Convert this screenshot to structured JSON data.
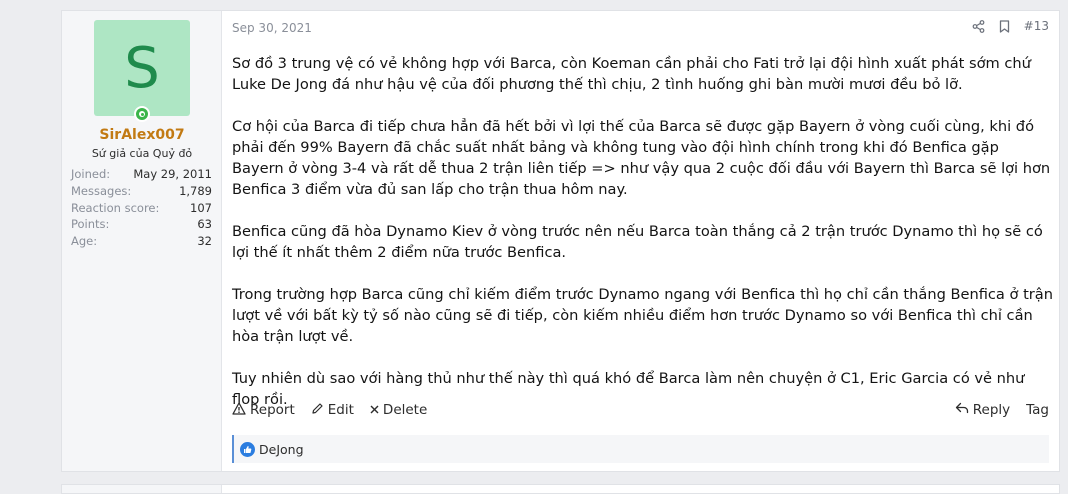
{
  "user": {
    "avatar_letter": "S",
    "username": "SirAlex007",
    "title": "Sứ giả của Quỷ đỏ",
    "stats": [
      {
        "label": "Joined:",
        "value": "May 29, 2011"
      },
      {
        "label": "Messages:",
        "value": "1,789"
      },
      {
        "label": "Reaction score:",
        "value": "107"
      },
      {
        "label": "Points:",
        "value": "63"
      },
      {
        "label": "Age:",
        "value": "32"
      }
    ]
  },
  "post": {
    "date": "Sep 30, 2021",
    "number": "#13",
    "paragraphs": [
      "Sơ đồ 3 trung vệ có vẻ không hợp với Barca, còn Koeman cần phải cho Fati trở lại đội hình xuất phát sớm chứ Luke De Jong đá như hậu vệ của đối phương thế thì chịu, 2 tình huống ghi bàn mười mươi đều bỏ lỡ.",
      "Cơ hội của Barca đi tiếp chưa hẳn đã hết bởi vì lợi thế của Barca sẽ được gặp Bayern ở vòng cuối cùng, khi đó phải đến 99% Bayern đã chắc suất nhất bảng và không tung vào đội hình chính trong khi đó Benfica gặp Bayern ở vòng 3-4 và rất dễ thua 2 trận liên tiếp => như vậy qua 2 cuộc đối đầu với Bayern thì Barca sẽ lợi hơn Benfica 3 điểm vừa đủ san lấp cho trận thua hôm nay.",
      "Benfica cũng đã hòa Dynamo Kiev ở vòng trước nên nếu Barca toàn thắng cả 2 trận trước Dynamo thì họ sẽ có lợi thế ít nhất thêm 2 điểm nữa trước Benfica.",
      "Trong trường hợp Barca cũng chỉ kiếm điểm trước Dynamo ngang với Benfica thì họ chỉ cần thắng Benfica ở trận lượt về với bất kỳ tỷ số nào cũng sẽ đi tiếp, còn kiếm nhiều điểm hơn trước Dynamo so với Benfica thì chỉ cần hòa trận lượt về.",
      "Tuy nhiên dù sao với hàng thủ như thế này thì quá khó để Barca làm nên chuyện ở C1, Eric Garcia có vẻ như flop rồi."
    ]
  },
  "actions": {
    "report": "Report",
    "edit": "Edit",
    "delete": "Delete",
    "reply": "Reply",
    "tag": "Tag"
  },
  "reactions": {
    "users": "DeJong"
  },
  "icons": {
    "share": "share-icon",
    "bookmark": "bookmark-icon",
    "report": "warning-icon",
    "edit": "pencil-icon",
    "delete": "close-icon",
    "reply": "reply-icon",
    "like": "thumbs-up-icon"
  },
  "colors": {
    "username": "#c27a13",
    "avatar_bg": "#aee6c4",
    "avatar_letter": "#1f8b4c",
    "online": "#3bb54a",
    "like": "#2b7de0"
  }
}
